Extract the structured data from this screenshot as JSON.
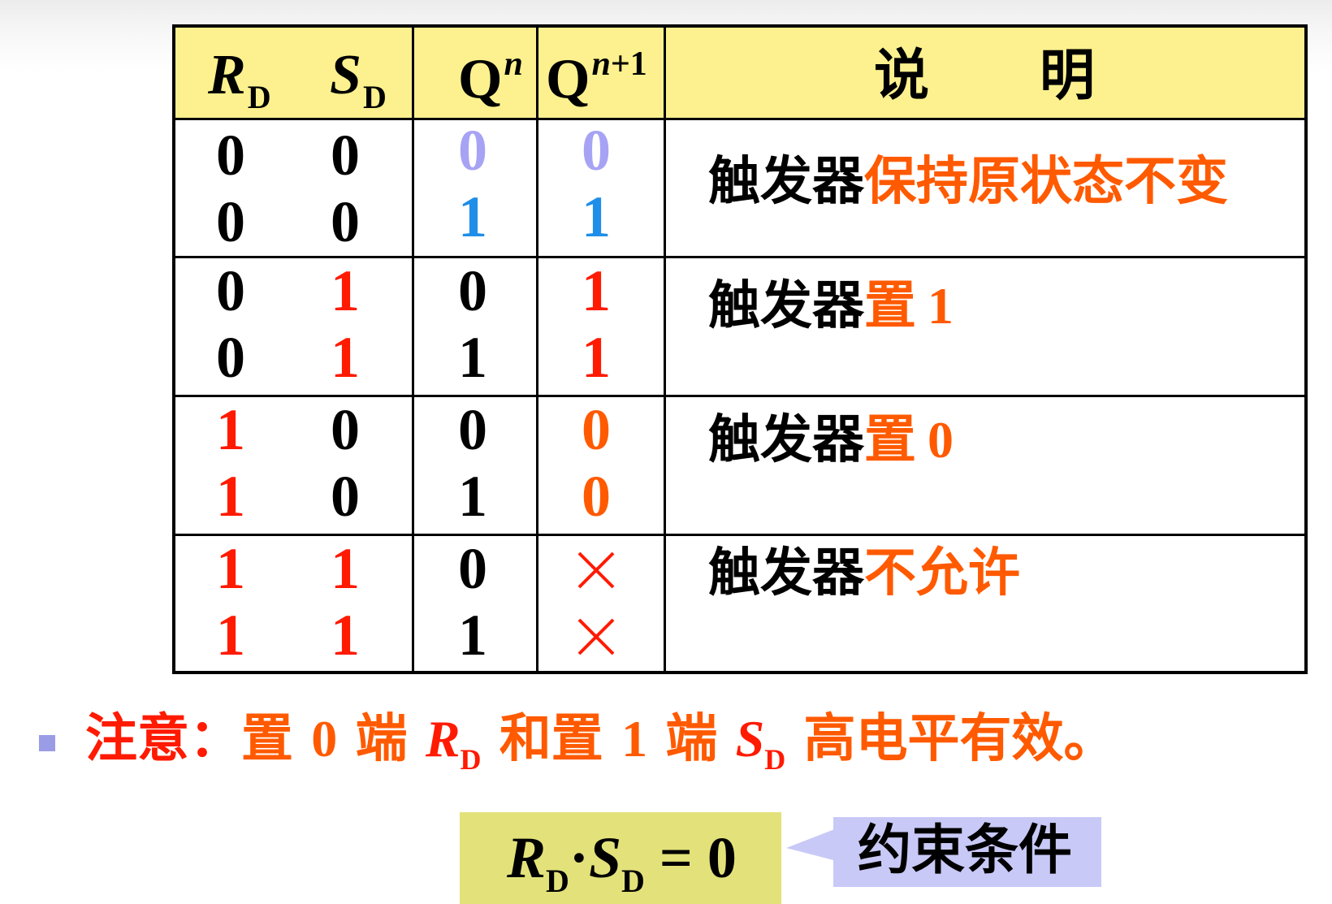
{
  "table": {
    "headers": {
      "rd": {
        "var": "R",
        "sub": "D"
      },
      "sd": {
        "var": "S",
        "sub": "D"
      },
      "qn": {
        "base": "Q",
        "sup": "n"
      },
      "qn1": {
        "base": "Q",
        "sup_var": "n",
        "sup_rest": "+1"
      },
      "desc": "说　　明"
    },
    "rows": [
      {
        "rd": "0",
        "sd": "0",
        "qn": "0",
        "qn1": "0"
      },
      {
        "rd": "0",
        "sd": "0",
        "qn": "1",
        "qn1": "1"
      },
      {
        "rd": "0",
        "sd": "1",
        "qn": "0",
        "qn1": "1"
      },
      {
        "rd": "0",
        "sd": "1",
        "qn": "1",
        "qn1": "1"
      },
      {
        "rd": "1",
        "sd": "0",
        "qn": "0",
        "qn1": "0"
      },
      {
        "rd": "1",
        "sd": "0",
        "qn": "1",
        "qn1": "0"
      },
      {
        "rd": "1",
        "sd": "1",
        "qn": "0",
        "qn1": "×"
      },
      {
        "rd": "1",
        "sd": "1",
        "qn": "1",
        "qn1": "×"
      }
    ],
    "descriptions": [
      {
        "lead": "触发器",
        "highlight": "保持原状态不变",
        "num": ""
      },
      {
        "lead": "触发器",
        "highlight": "置",
        "num": "1"
      },
      {
        "lead": "触发器",
        "highlight": "置",
        "num": "0"
      },
      {
        "lead": "触发器",
        "highlight": "不允许",
        "num": ""
      }
    ]
  },
  "note": {
    "label": "注意：",
    "part1": "置",
    "num0": "0",
    "part2": "端",
    "rd_var": "R",
    "rd_sub": "D",
    "part3": "和置",
    "num1": "1",
    "part4": "端",
    "sd_var": "S",
    "sd_sub": "D",
    "part5": "高电平有效。"
  },
  "constraint": {
    "r_var": "R",
    "r_sub": "D",
    "dot": "·",
    "s_var": "S",
    "s_sub": "D",
    "eq": "= 0",
    "label": "约束条件"
  },
  "colors": {
    "header_bg": "#fcf18e",
    "red": "#ff1a00",
    "orange": "#ff5a00",
    "lavender": "#a7a3f4",
    "blue": "#1f8ee8",
    "constraint_bg": "#e3e27a",
    "callout_bg": "#c9c9f7",
    "bullet": "#9b9ce6"
  }
}
